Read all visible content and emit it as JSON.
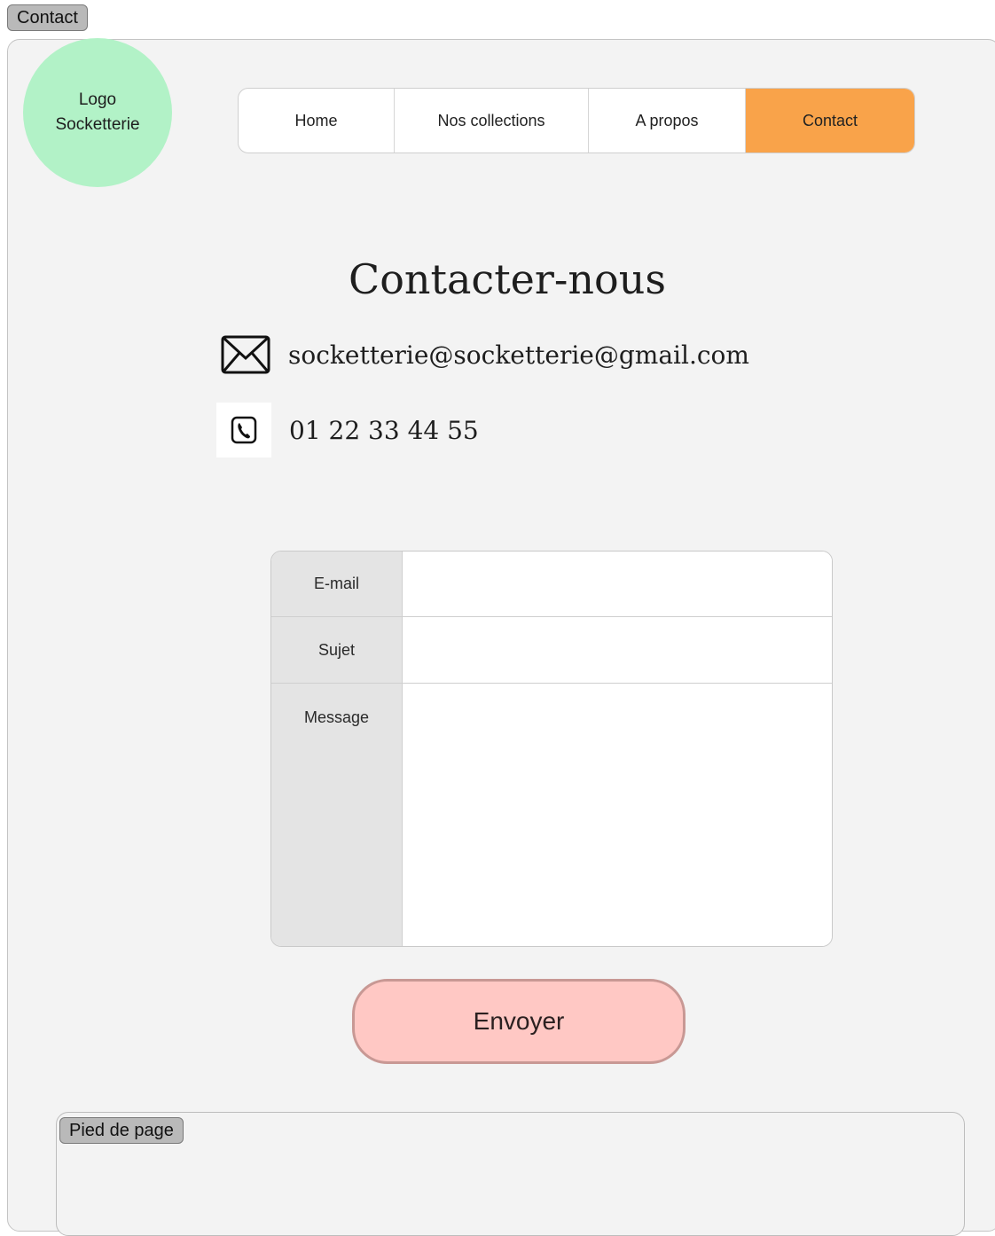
{
  "page_tag": "Contact",
  "logo": {
    "text": "Logo\nSocketterie"
  },
  "nav": {
    "items": [
      {
        "label": "Home",
        "active": false
      },
      {
        "label": "Nos collections",
        "active": false
      },
      {
        "label": "A propos",
        "active": false
      },
      {
        "label": "Contact",
        "active": true
      }
    ]
  },
  "contact": {
    "title": "Contacter-nous",
    "email": "socketterie@socketterie@gmail.com",
    "email_icon": "envelope-icon",
    "phone": "01 22 33 44 55",
    "phone_icon": "phone-icon"
  },
  "form": {
    "email_label": "E-mail",
    "email_value": "",
    "subject_label": "Sujet",
    "subject_value": "",
    "message_label": "Message",
    "message_value": ""
  },
  "send_button": {
    "label": "Envoyer"
  },
  "footer": {
    "tag": "Pied de page"
  },
  "colors": {
    "accent_nav_active": "#f9a34a",
    "logo_bg": "#b2f2c7",
    "send_button_bg": "#ffc8c4",
    "send_button_border": "#c89894"
  }
}
